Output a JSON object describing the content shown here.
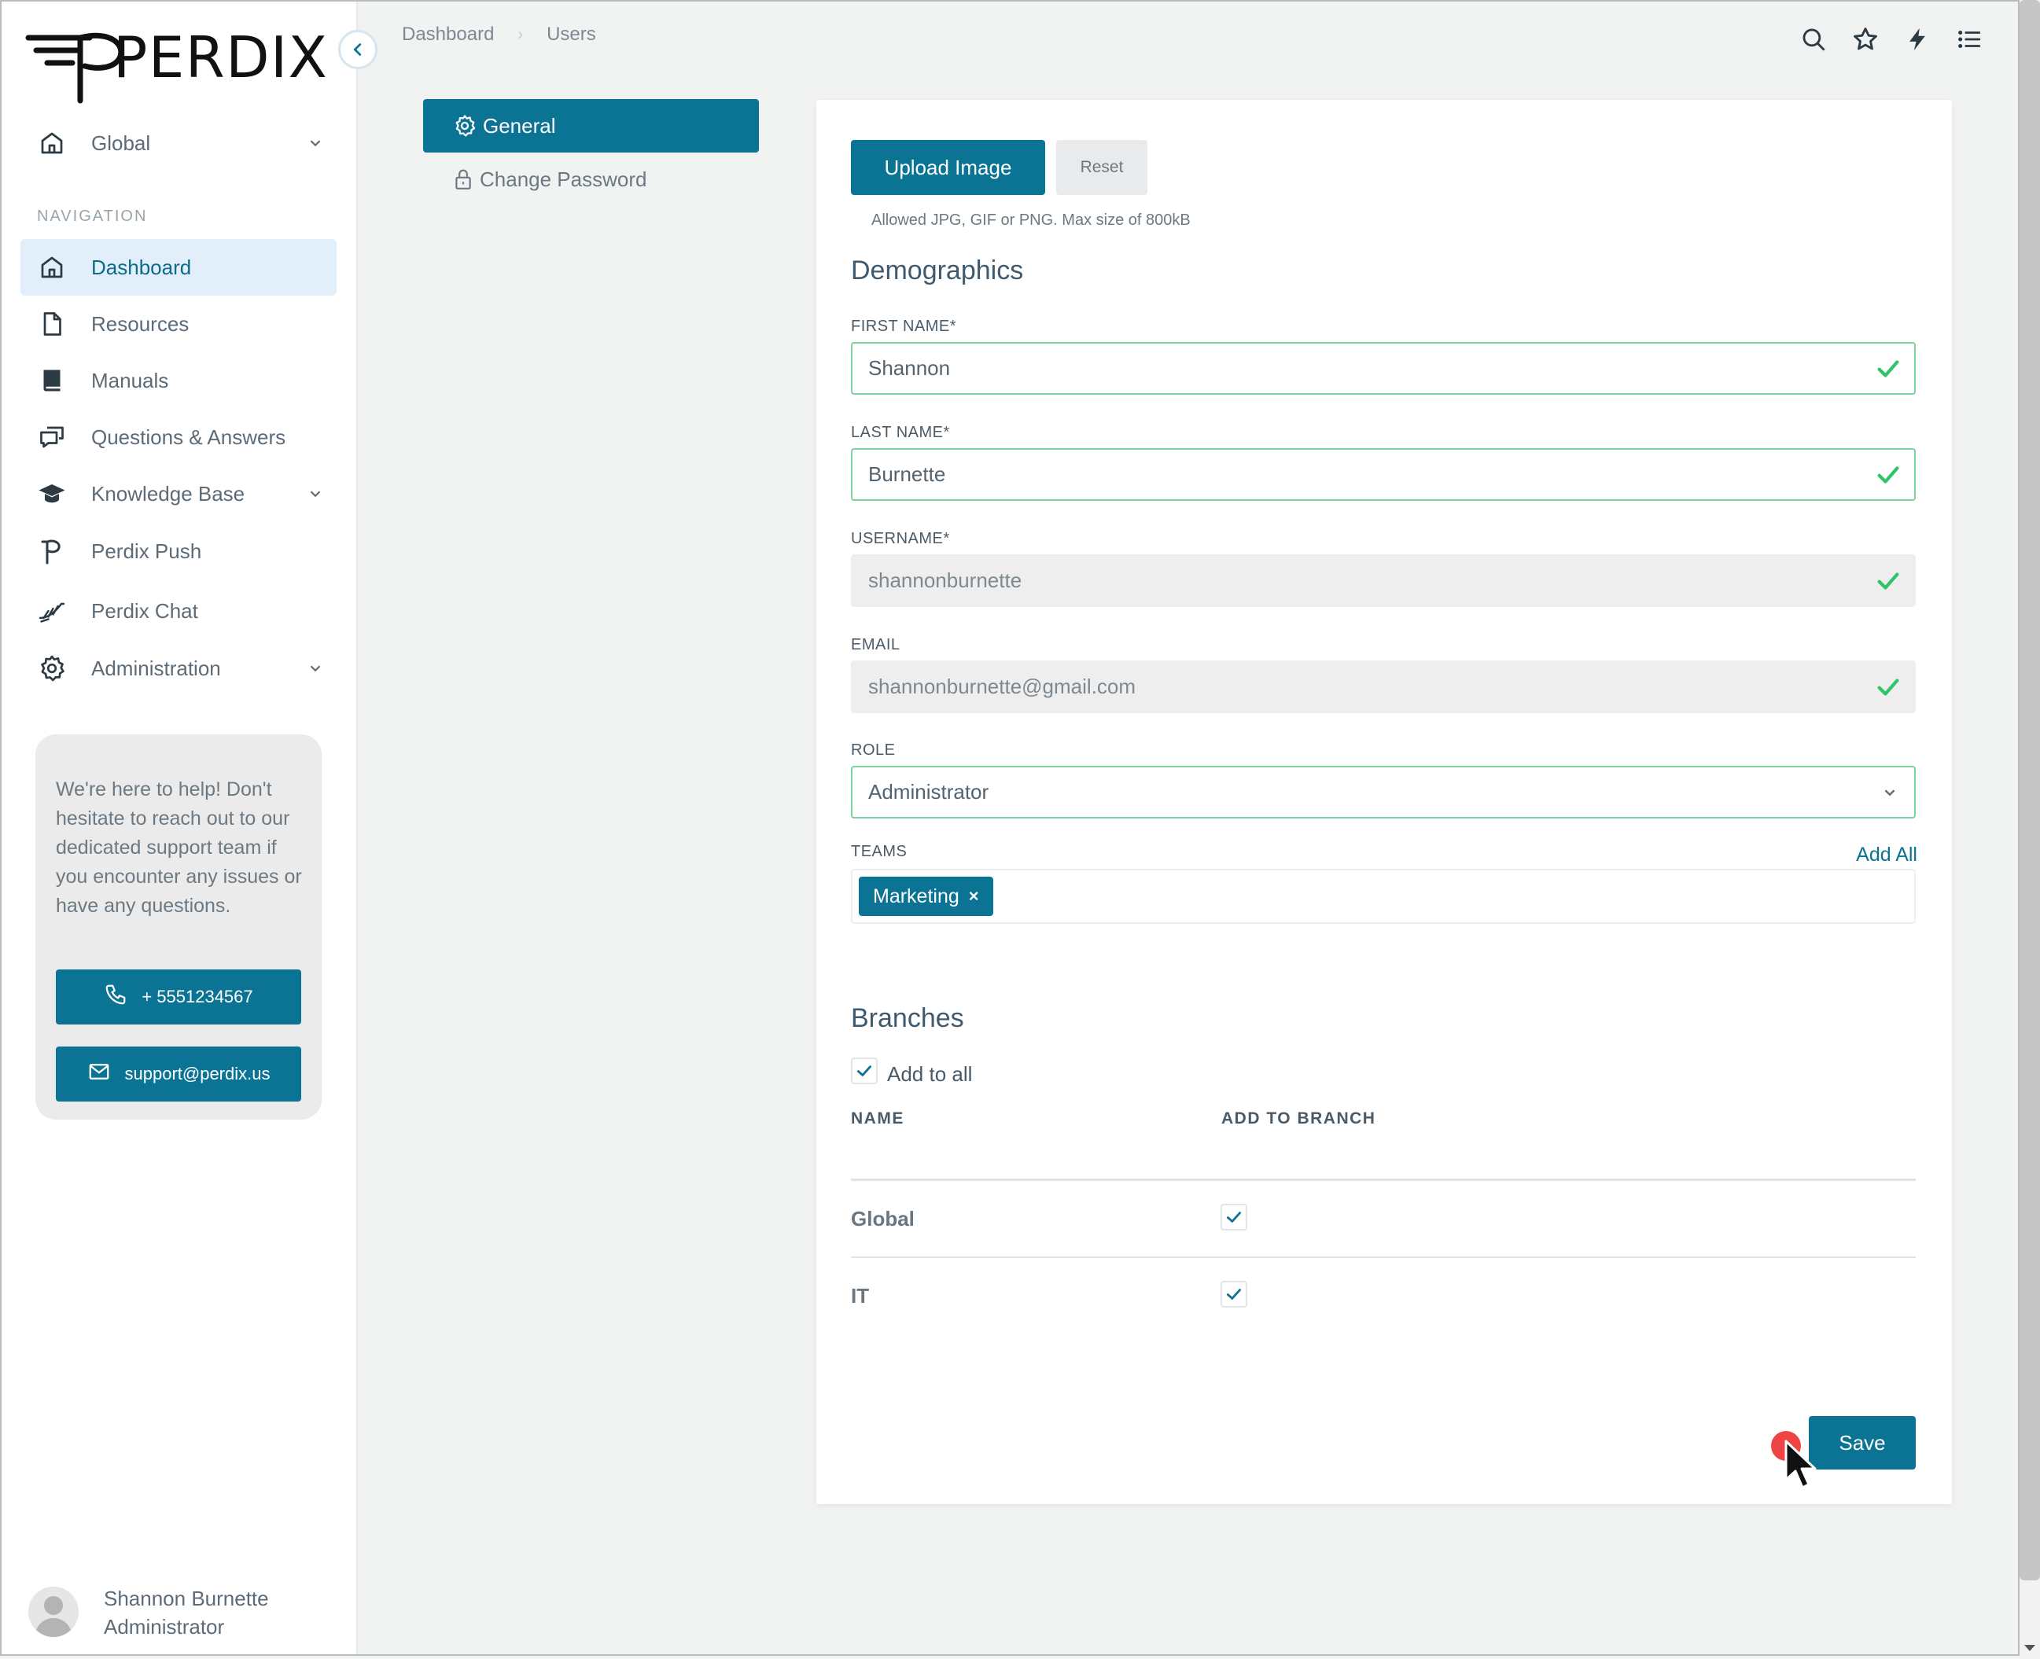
{
  "app": {
    "brand": "PERDIX"
  },
  "sidebar": {
    "workspace_selector": "Global",
    "nav_heading": "NAVIGATION",
    "items": [
      {
        "label": "Dashboard",
        "icon": "home-icon",
        "active": true
      },
      {
        "label": "Resources",
        "icon": "file-icon"
      },
      {
        "label": "Manuals",
        "icon": "book-icon"
      },
      {
        "label": "Questions & Answers",
        "icon": "chat-icon"
      },
      {
        "label": "Knowledge Base",
        "icon": "graduation-cap-icon",
        "expandable": true
      },
      {
        "label": "Perdix Push",
        "icon": "perdix-p-icon"
      },
      {
        "label": "Perdix Chat",
        "icon": "bird-icon"
      },
      {
        "label": "Administration",
        "icon": "gear-icon",
        "expandable": true
      }
    ],
    "support": {
      "text": "We're here to help! Don't hesitate to reach out to our dedicated support team if you encounter any issues or have any questions.",
      "phone": "+ 5551234567",
      "email": "support@perdix.us"
    },
    "user": {
      "name": "Shannon Burnette",
      "role": "Administrator"
    }
  },
  "breadcrumb": {
    "items": [
      "Dashboard",
      "Users"
    ],
    "separator": "›"
  },
  "toolbar_icons": [
    "search-icon",
    "star-icon",
    "lightning-icon",
    "list-icon"
  ],
  "settings_tabs": {
    "general": "General",
    "change_password": "Change Password"
  },
  "profile_form": {
    "upload_label": "Upload Image",
    "reset_label": "Reset",
    "upload_hint": "Allowed JPG, GIF or PNG. Max size of 800kB",
    "demographics_title": "Demographics",
    "first_name": {
      "label": "FIRST NAME*",
      "value": "Shannon"
    },
    "last_name": {
      "label": "LAST NAME*",
      "value": "Burnette"
    },
    "username": {
      "label": "USERNAME*",
      "value": "shannonburnette"
    },
    "email": {
      "label": "EMAIL",
      "value": "shannonburnette@gmail.com"
    },
    "role": {
      "label": "ROLE",
      "value": "Administrator"
    },
    "teams": {
      "label": "TEAMS",
      "add_all": "Add All",
      "tags": [
        "Marketing"
      ],
      "remove_glyph": "×"
    },
    "branches_title": "Branches",
    "add_to_all_label": "Add to all",
    "add_to_all_checked": true,
    "branch_table": {
      "headers": [
        "NAME",
        "ADD TO BRANCH"
      ],
      "rows": [
        {
          "name": "Global",
          "checked": true
        },
        {
          "name": "IT",
          "checked": true
        }
      ]
    },
    "save_label": "Save"
  },
  "colors": {
    "primary": "#0b7394",
    "active_nav_bg": "#e3eefb",
    "valid_green": "#2fc36a",
    "cursor_dot": "#ee4444"
  }
}
